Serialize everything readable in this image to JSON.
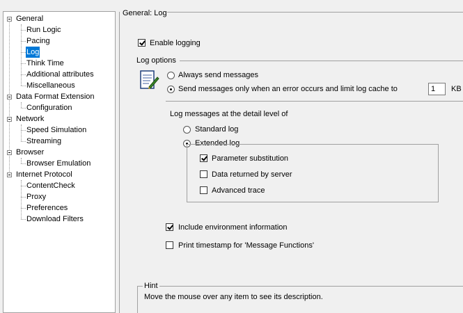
{
  "tree": {
    "nodes": [
      {
        "label": "General",
        "level": 0,
        "expanded": true
      },
      {
        "label": "Run Logic",
        "level": 1
      },
      {
        "label": "Pacing",
        "level": 1
      },
      {
        "label": "Log",
        "level": 1,
        "selected": true
      },
      {
        "label": "Think Time",
        "level": 1
      },
      {
        "label": "Additional attributes",
        "level": 1
      },
      {
        "label": "Miscellaneous",
        "level": 1
      },
      {
        "label": "Data Format Extension",
        "level": 0,
        "expanded": true
      },
      {
        "label": "Configuration",
        "level": 1
      },
      {
        "label": "Network",
        "level": 0,
        "expanded": true
      },
      {
        "label": "Speed Simulation",
        "level": 1
      },
      {
        "label": "Streaming",
        "level": 1
      },
      {
        "label": "Browser",
        "level": 0,
        "expanded": true
      },
      {
        "label": "Browser Emulation",
        "level": 1
      },
      {
        "label": "Internet Protocol",
        "level": 0,
        "expanded": true
      },
      {
        "label": "ContentCheck",
        "level": 1
      },
      {
        "label": "Proxy",
        "level": 1
      },
      {
        "label": "Preferences",
        "level": 1
      },
      {
        "label": "Download Filters",
        "level": 1
      }
    ]
  },
  "panel": {
    "title": "General: Log",
    "enable_logging": {
      "label": "Enable logging",
      "checked": true
    },
    "log_options": {
      "title": "Log options",
      "always_send": {
        "label": "Always send messages",
        "selected": false
      },
      "send_on_error": {
        "label": "Send messages only when an error occurs and limit log cache to",
        "selected": true
      },
      "cache_value": "1",
      "cache_unit": "KB"
    },
    "detail": {
      "title": "Log messages at the detail level of",
      "standard": {
        "label": "Standard log",
        "selected": false
      },
      "extended": {
        "label": "Extended log",
        "selected": true
      },
      "param_sub": {
        "label": "Parameter substitution",
        "checked": true
      },
      "data_returned": {
        "label": "Data returned by server",
        "checked": false
      },
      "advanced_trace": {
        "label": "Advanced trace",
        "checked": false
      }
    },
    "include_env": {
      "label": "Include environment information",
      "checked": true
    },
    "print_timestamp": {
      "label": "Print timestamp for 'Message Functions'",
      "checked": false
    },
    "hint": {
      "title": "Hint",
      "text": "Move the mouse over any item to see its description."
    }
  }
}
